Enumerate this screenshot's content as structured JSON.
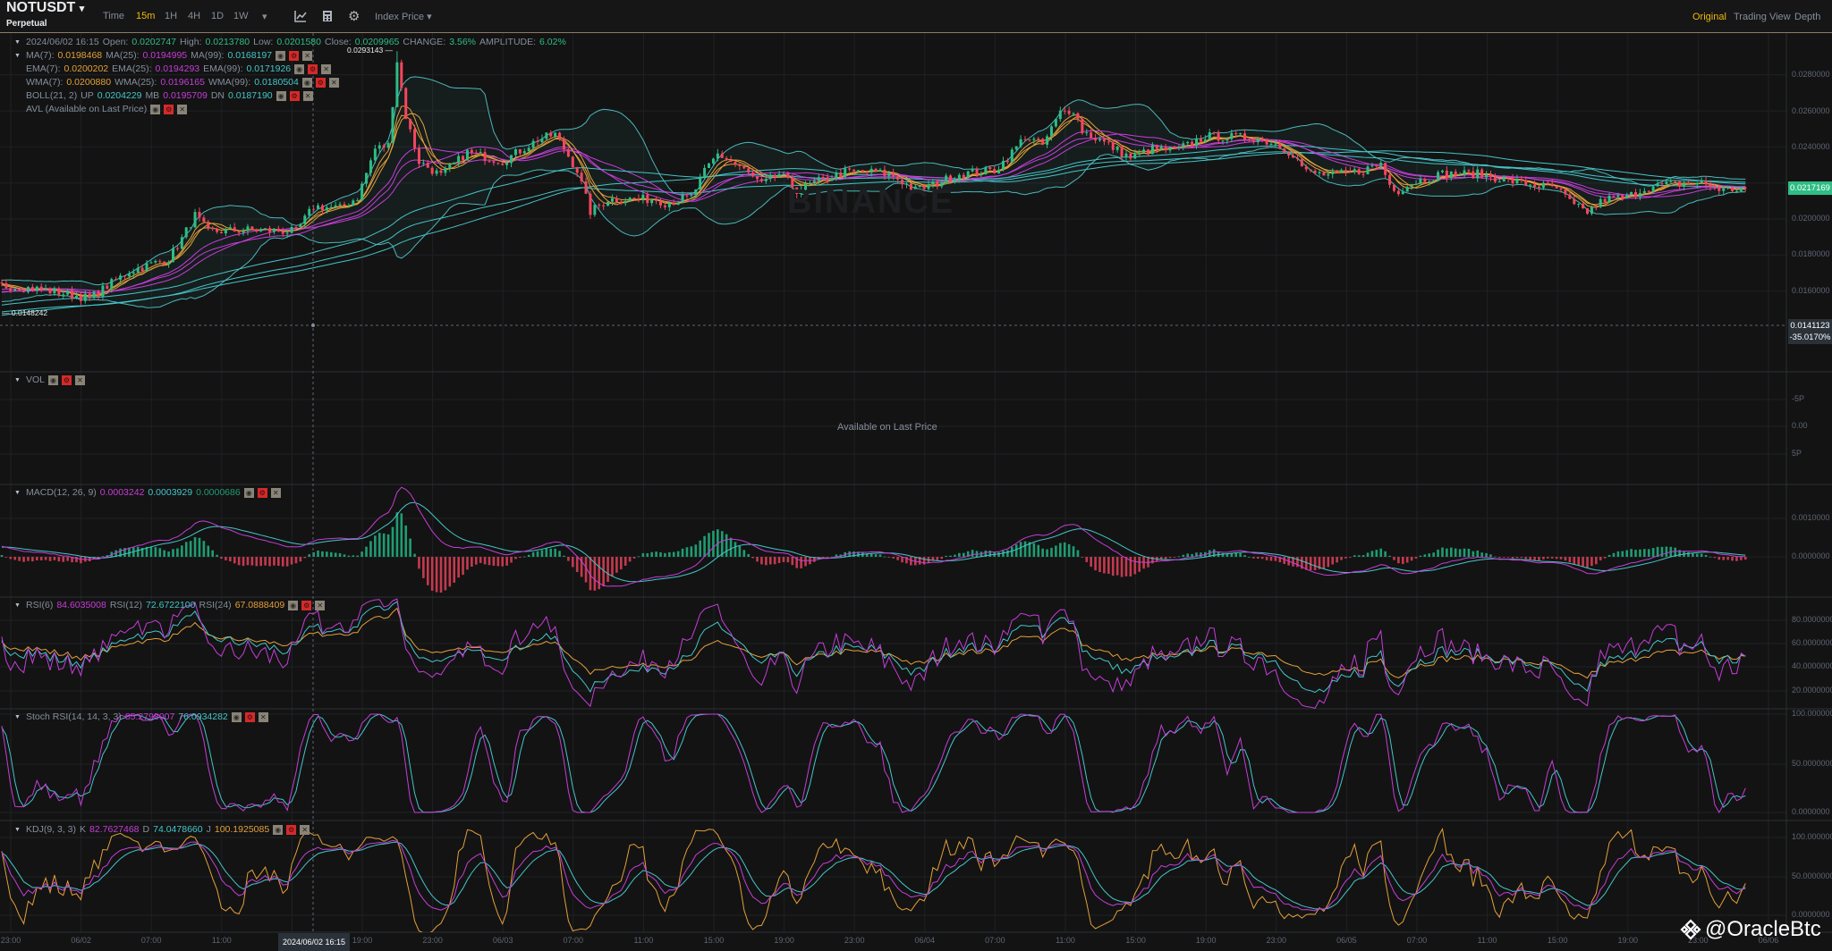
{
  "header": {
    "symbol": "NOTUSDT",
    "symbol_caret": "▾",
    "contract": "Perpetual",
    "intervals": [
      "Time",
      "15m",
      "1H",
      "4H",
      "1D",
      "1W"
    ],
    "active_interval": "15m",
    "more_caret": "▾",
    "index_price": "Index Price ▾",
    "views": [
      "Original",
      "Trading View",
      "Depth"
    ],
    "active_view": "Original"
  },
  "ohlc": {
    "date": "2024/06/02 16:15",
    "open_l": "Open:",
    "open": "0.0202747",
    "high_l": "High:",
    "high": "0.0213780",
    "low_l": "Low:",
    "low": "0.0201580",
    "close_l": "Close:",
    "close": "0.0209965",
    "change_l": "CHANGE:",
    "change": "3.56%",
    "amp_l": "AMPLITUDE:",
    "amp": "6.02%"
  },
  "ma": {
    "l1": "MA(7):",
    "v1": "0.0198468",
    "l2": "MA(25):",
    "v2": "0.0194995",
    "l3": "MA(99):",
    "v3": "0.0168197"
  },
  "ema": {
    "l1": "EMA(7):",
    "v1": "0.0200202",
    "l2": "EMA(25):",
    "v2": "0.0194293",
    "l3": "EMA(99):",
    "v3": "0.0171926"
  },
  "wma": {
    "l1": "WMA(7):",
    "v1": "0.0200880",
    "l2": "WMA(25):",
    "v2": "0.0196165",
    "l3": "WMA(99):",
    "v3": "0.0180504"
  },
  "boll": {
    "label": "BOLL(21, 2)",
    "up_l": "UP",
    "up": "0.0204229",
    "mb_l": "MB",
    "mb": "0.0195709",
    "dn_l": "DN",
    "dn": "0.0187190"
  },
  "avl": {
    "label": "AVL (Available on Last Price)"
  },
  "vol": {
    "label": "VOL",
    "notice": "Available on Last Price",
    "axis": [
      "-5P",
      "0.00",
      "5P"
    ]
  },
  "macd": {
    "label": "MACD(12, 26, 9)",
    "v1": "0.0003242",
    "v2": "0.0003929",
    "v3": "0.0000686",
    "axis": [
      "0.0010000",
      "0.0000000"
    ]
  },
  "rsi": {
    "label": "RSI(6)",
    "v1": "84.6035008",
    "l2": "RSI(12)",
    "v2": "72.6722100",
    "l3": "RSI(24)",
    "v3": "67.0888409",
    "axis": [
      "80.0000000",
      "60.0000000",
      "40.0000000",
      "20.0000000"
    ]
  },
  "stoch": {
    "label": "Stoch RSI(14, 14, 3, 3)",
    "v1": "85.2798007",
    "v2": "76.0934282",
    "axis": [
      "100.0000000",
      "50.0000000",
      "0.0000000"
    ]
  },
  "kdj": {
    "label": "KDJ(9, 3, 3)",
    "k_l": "K",
    "k": "82.7627468",
    "d_l": "D",
    "d": "74.0478660",
    "j_l": "J",
    "j": "100.1925085",
    "axis": [
      "100.0000000",
      "50.0000000",
      "0.0000000"
    ]
  },
  "icons": {
    "eye": "◉",
    "gear": "⚙",
    "close": "✕"
  },
  "price_axis": [
    "0.0280000",
    "0.0260000",
    "0.0240000",
    "0.0200000",
    "0.0180000",
    "0.0160000"
  ],
  "last_price": "0.0217169",
  "crosshair": {
    "price": "0.0141123",
    "pct": "-35.0170%",
    "time": "2024/06/02 16:15"
  },
  "max_label": "0.0293143",
  "min_label": "0.0148242",
  "time_axis": [
    "23:00",
    "06/02",
    "07:00",
    "11:00",
    "",
    "19:00",
    "23:00",
    "06/03",
    "07:00",
    "11:00",
    "15:00",
    "19:00",
    "23:00",
    "06/04",
    "07:00",
    "11:00",
    "15:00",
    "19:00",
    "23:00",
    "06/05",
    "07:00",
    "11:00",
    "15:00",
    "19:00",
    "23:00",
    "06/06"
  ],
  "watermark": "BINANCE",
  "credit": "@OracleBtc",
  "colors": {
    "up": "#2ebd85",
    "down": "#f6465d",
    "fast": "#e3a03a",
    "mid": "#c53ed8",
    "slow": "#45c5c8",
    "accent": "#f0b90b"
  },
  "chart_data": {
    "type": "candlestick",
    "interval": "15m",
    "price_ticks": [
      0.028,
      0.026,
      0.024,
      0.022,
      0.02,
      0.018,
      0.016
    ],
    "ylim": [
      0.0135,
      0.03
    ],
    "close_anchors": [
      [
        -100,
        0.0128
      ],
      [
        -40,
        0.015
      ],
      [
        0,
        0.0163
      ],
      [
        9,
        0.0161
      ],
      [
        20,
        0.0156
      ],
      [
        29,
        0.0171
      ],
      [
        38,
        0.0178
      ],
      [
        41,
        0.0189
      ],
      [
        44,
        0.0202
      ],
      [
        47,
        0.0193
      ],
      [
        57,
        0.0194
      ],
      [
        67,
        0.0193
      ],
      [
        71,
        0.0207
      ],
      [
        77,
        0.0206
      ],
      [
        81,
        0.0212
      ],
      [
        85,
        0.0239
      ],
      [
        88,
        0.0241
      ],
      [
        90,
        0.0288
      ],
      [
        92,
        0.0257
      ],
      [
        95,
        0.0232
      ],
      [
        100,
        0.0224
      ],
      [
        106,
        0.0237
      ],
      [
        114,
        0.0232
      ],
      [
        122,
        0.0244
      ],
      [
        126,
        0.0247
      ],
      [
        131,
        0.0227
      ],
      [
        134,
        0.0204
      ],
      [
        138,
        0.0211
      ],
      [
        149,
        0.0211
      ],
      [
        151,
        0.0209
      ],
      [
        157,
        0.0212
      ],
      [
        160,
        0.0226
      ],
      [
        163,
        0.0236
      ],
      [
        168,
        0.0229
      ],
      [
        173,
        0.0219
      ],
      [
        177,
        0.0225
      ],
      [
        181,
        0.0216
      ],
      [
        186,
        0.0221
      ],
      [
        192,
        0.0226
      ],
      [
        199,
        0.0226
      ],
      [
        203,
        0.0224
      ],
      [
        208,
        0.0216
      ],
      [
        212,
        0.0219
      ],
      [
        218,
        0.0225
      ],
      [
        226,
        0.0227
      ],
      [
        229,
        0.0234
      ],
      [
        233,
        0.0246
      ],
      [
        237,
        0.0241
      ],
      [
        241,
        0.0259
      ],
      [
        244,
        0.0261
      ],
      [
        246,
        0.0249
      ],
      [
        252,
        0.0241
      ],
      [
        257,
        0.0234
      ],
      [
        262,
        0.0239
      ],
      [
        267,
        0.0238
      ],
      [
        271,
        0.0242
      ],
      [
        274,
        0.0246
      ],
      [
        285,
        0.0245
      ],
      [
        290,
        0.0242
      ],
      [
        294,
        0.0236
      ],
      [
        297,
        0.0226
      ],
      [
        303,
        0.0224
      ],
      [
        310,
        0.0227
      ],
      [
        314,
        0.0231
      ],
      [
        316,
        0.0219
      ],
      [
        318,
        0.0216
      ],
      [
        322,
        0.0221
      ],
      [
        328,
        0.0225
      ],
      [
        336,
        0.0225
      ],
      [
        346,
        0.022
      ],
      [
        354,
        0.0217
      ],
      [
        358,
        0.0207
      ],
      [
        361,
        0.0204
      ],
      [
        365,
        0.0211
      ],
      [
        370,
        0.0212
      ],
      [
        374,
        0.0217
      ],
      [
        379,
        0.0219
      ],
      [
        387,
        0.022
      ],
      [
        392,
        0.0216
      ],
      [
        397,
        0.0217169
      ]
    ]
  }
}
